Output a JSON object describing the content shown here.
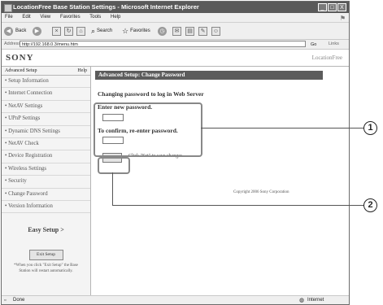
{
  "window": {
    "title": "LocationFree Base Station Settings - Microsoft Internet Explorer",
    "buttons": [
      "_",
      "□",
      "X"
    ]
  },
  "menu": [
    "File",
    "Edit",
    "View",
    "Favorites",
    "Tools",
    "Help"
  ],
  "toolbar": {
    "back": "Back",
    "search": "Search",
    "favorites": "Favorites"
  },
  "address": {
    "label": "Address",
    "url": "http://192.168.0.3/menu.htm",
    "go": "Go",
    "links": "Links"
  },
  "brand": {
    "logo": "SONY",
    "product": "LocationFree"
  },
  "sidebar": {
    "header": "Advanced Setup",
    "help": "Help",
    "items": [
      "• Setup Information",
      "• Internet Connection",
      "• NetAV Settings",
      "• UPnP Settings",
      "• Dynamic DNS Settings",
      "• NetAV Check",
      "• Device Registration",
      "• Wireless Settings",
      "• Security",
      "• Change Password",
      "• Version Information"
    ],
    "easy_setup": "Easy Setup >",
    "exit_button": "Exit Setup",
    "note": "*When you click \"Exit Setup\" the Base Station will restart automatically."
  },
  "main": {
    "header": "Advanced Setup: Change Password",
    "subtitle": "Changing password to log in Web Server",
    "new_password_label": "Enter new password.",
    "confirm_label": "To confirm, re-enter password.",
    "set_button": "Set",
    "set_hint": "Click \"Set\" to save changes.",
    "copyright": "Copyright 2006 Sony Corporation"
  },
  "status": {
    "left": "Done",
    "right": "Internet"
  },
  "callouts": [
    "1",
    "2"
  ]
}
